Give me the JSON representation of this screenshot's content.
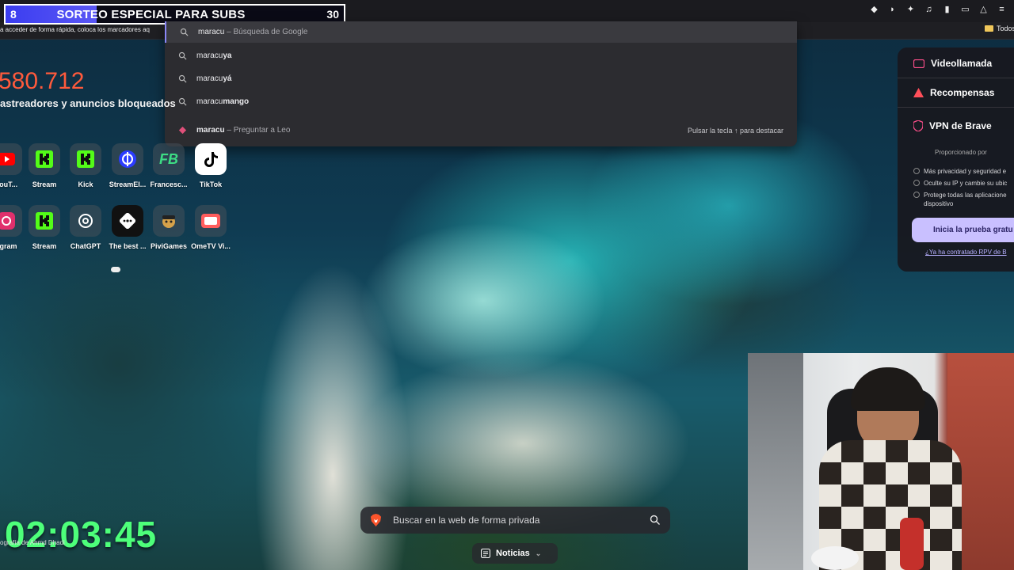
{
  "banner": {
    "left_count": "8",
    "title": "SORTEO ESPECIAL PARA SUBS",
    "right_count": "30",
    "progress": 0.27
  },
  "bookmarks": {
    "hint": "a acceder de forma rápida, coloca los marcadores aq",
    "folder_label": "Todos"
  },
  "autocomplete": {
    "suggestions": [
      {
        "typed": "maracu",
        "completion": "",
        "suffix": " – Búsqueda de Google"
      },
      {
        "typed": "maracu",
        "completion": "ya",
        "suffix": ""
      },
      {
        "typed": "maracu",
        "completion": "yá",
        "suffix": ""
      },
      {
        "typed": "maracu",
        "completion": "mango",
        "suffix": ""
      }
    ],
    "leo": {
      "typed": "maracu",
      "suffix": " – Preguntar a Leo",
      "hint": "Pulsar la tecla ↑ para destacar"
    }
  },
  "stats": {
    "number": "580.712",
    "label": "astreadores y anuncios bloqueados"
  },
  "top_sites": [
    {
      "label": "YouT...",
      "icon": "youtube-icon",
      "color": "#ff0000"
    },
    {
      "label": "Stream",
      "icon": "kick-icon",
      "color": "#53fc18"
    },
    {
      "label": "Kick",
      "icon": "kick-icon",
      "color": "#53fc18"
    },
    {
      "label": "StreamEl...",
      "icon": "streamelements-icon",
      "color": "#2b3cff"
    },
    {
      "label": "Francesc...",
      "icon": "fb-icon",
      "color": "#3ddc84"
    },
    {
      "label": "TikTok",
      "icon": "tiktok-icon",
      "color": "#000000"
    },
    {
      "label": "agram",
      "icon": "instagram-icon",
      "color": "#e1306c"
    },
    {
      "label": "Stream",
      "icon": "kick-icon",
      "color": "#53fc18"
    },
    {
      "label": "ChatGPT",
      "icon": "chatgpt-icon",
      "color": "#ffffff"
    },
    {
      "label": "The best ...",
      "icon": "dice-icon",
      "color": "#111111"
    },
    {
      "label": "PiviGames",
      "icon": "pirate-icon",
      "color": "#d6a24a"
    },
    {
      "label": "OmeTV Vi...",
      "icon": "ometv-icon",
      "color": "#ff5d5d"
    }
  ],
  "vpn_card": {
    "items": [
      "Videollamada",
      "Recompensas",
      "VPN de Brave"
    ],
    "provided_by": "Proporcionado por",
    "features": [
      "Más privacidad y seguridad e",
      "Oculte su IP y cambie su ubic",
      "Protege todas las aplicacione dispositivo"
    ],
    "cta": "Inicia la prueba gratu",
    "link": "¿Ya ha contratado RPV de B"
  },
  "timer": {
    "value": "02:03:45",
    "credit": "ografía de Ahmd Dhadi"
  },
  "search": {
    "placeholder": "Buscar en la web de forma privada"
  },
  "news": {
    "label": "Noticias"
  },
  "colors": {
    "accent_purple": "#8a86f7",
    "stat_red": "#ff5a3c",
    "timer_green": "#4dff7a"
  }
}
